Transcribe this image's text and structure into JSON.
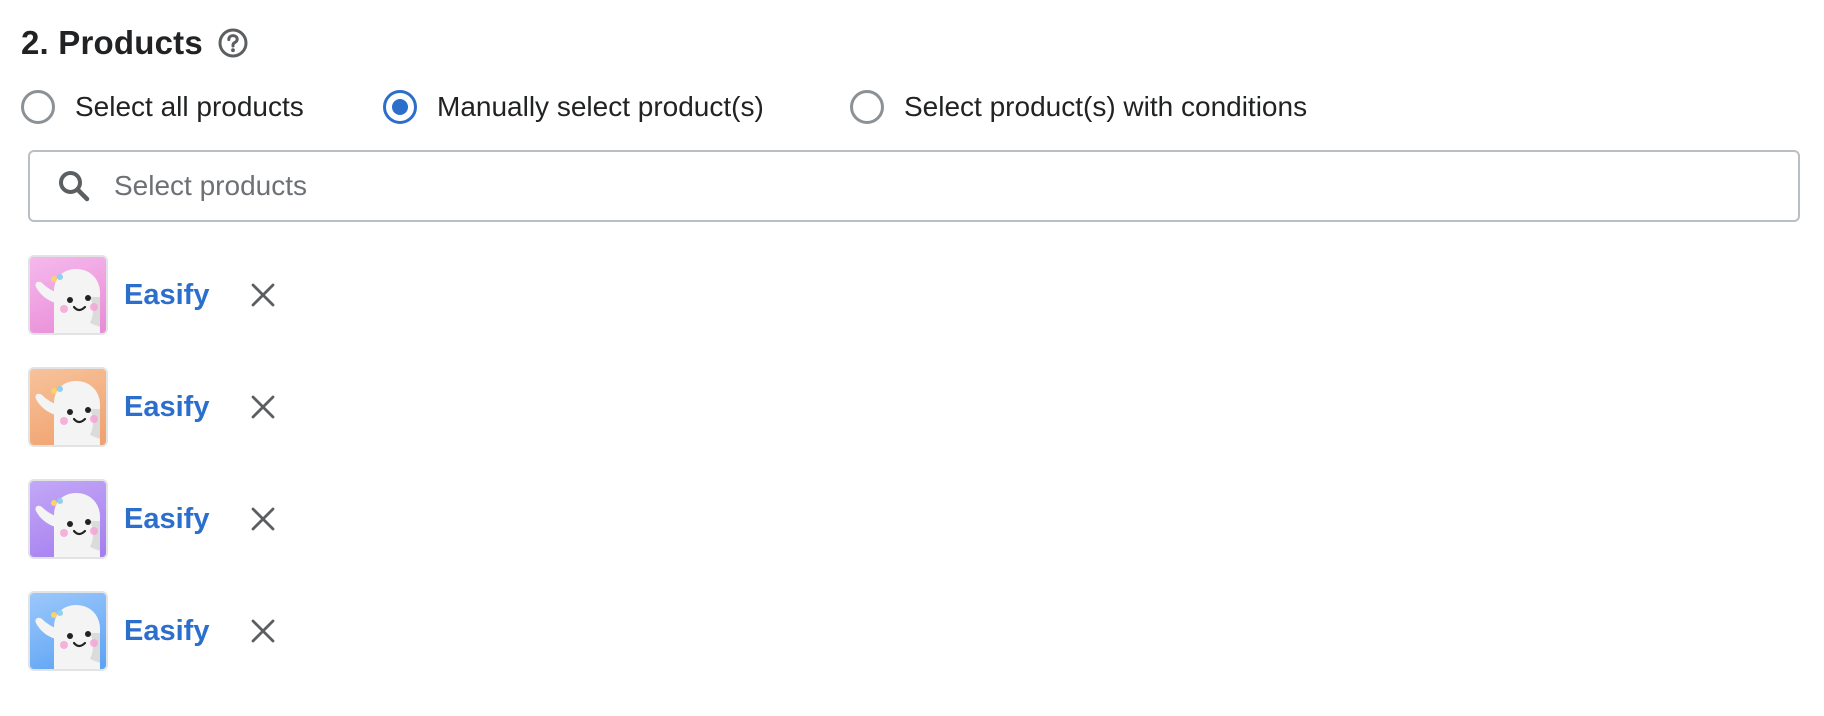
{
  "section": {
    "title": "2. Products",
    "help_icon": "question-circle-icon"
  },
  "selection_mode": {
    "options": [
      {
        "label": "Select all products",
        "checked": false
      },
      {
        "label": "Manually select product(s)",
        "checked": true
      },
      {
        "label": "Select product(s) with conditions",
        "checked": false
      }
    ]
  },
  "search": {
    "placeholder": "Select products",
    "value": "",
    "icon": "search-icon"
  },
  "products": [
    {
      "name": "Easify",
      "thumb_color": "#e98ad6",
      "remove_icon": "close-icon"
    },
    {
      "name": "Easify",
      "thumb_color": "#f0a06c",
      "remove_icon": "close-icon"
    },
    {
      "name": "Easify",
      "thumb_color": "#a47df0",
      "remove_icon": "close-icon"
    },
    {
      "name": "Easify",
      "thumb_color": "#5aa2f5",
      "remove_icon": "close-icon"
    }
  ],
  "colors": {
    "accent": "#2c6ecb",
    "text": "#202223",
    "border": "#babfc3"
  }
}
